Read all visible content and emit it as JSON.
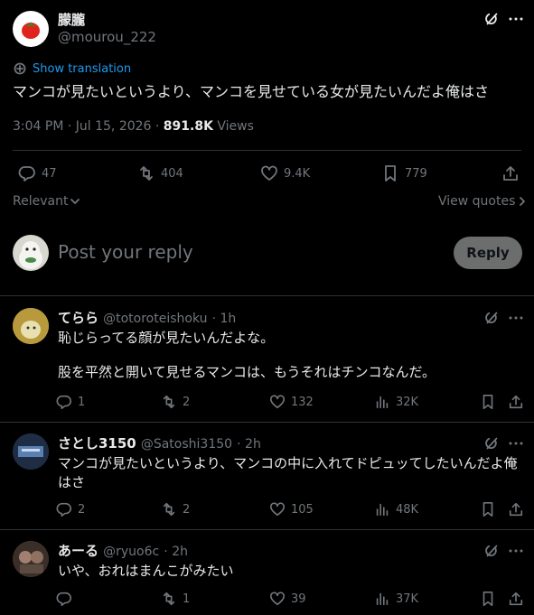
{
  "tweet": {
    "display_name": "朦朧",
    "handle": "@mourou_222",
    "show_translation": "Show translation",
    "text": "マンコが見たいというより、マンコを見せている女が見たいんだよ俺はさ",
    "time": "3:04 PM · Jul 15, 2026 · ",
    "views_count": "891.8K",
    "views_label": " Views",
    "stats": {
      "replies": "47",
      "retweets": "404",
      "likes": "9.4K",
      "bookmarks": "779"
    }
  },
  "sort": {
    "label": "Relevant",
    "view_quotes": "View quotes"
  },
  "composer": {
    "placeholder": "Post your reply",
    "reply_button": "Reply"
  },
  "replies": [
    {
      "name": "てらら",
      "handle": "@totoroteishoku",
      "time": "· 1h",
      "lines": [
        "恥じらってる顔が見たいんだよな。",
        "股を平然と開いて見せるマンコは、もうそれはチンコなんだ。"
      ],
      "stats": {
        "replies": "1",
        "retweets": "2",
        "likes": "132",
        "views": "32K"
      }
    },
    {
      "name": "さとし3150",
      "handle": "@Satoshi3150",
      "time": "· 2h",
      "lines": [
        "マンコが見たいというより、マンコの中に入れてドピュッてしたいんだよ俺",
        "はさ"
      ],
      "stats": {
        "replies": "2",
        "retweets": "2",
        "likes": "105",
        "views": "48K"
      }
    },
    {
      "name": "あーる",
      "handle": "@ryuo6c",
      "time": "· 2h",
      "lines": [
        "いや、おれはまんこがみたい"
      ],
      "stats": {
        "replies": "",
        "retweets": "1",
        "likes": "39",
        "views": "37K"
      }
    }
  ],
  "colors": {
    "background": "#000000",
    "text": "#e7e9ea",
    "muted": "#71767b",
    "link": "#1d9bf0",
    "divider": "#2f3336",
    "reply_button_bg": "#787a7a"
  }
}
